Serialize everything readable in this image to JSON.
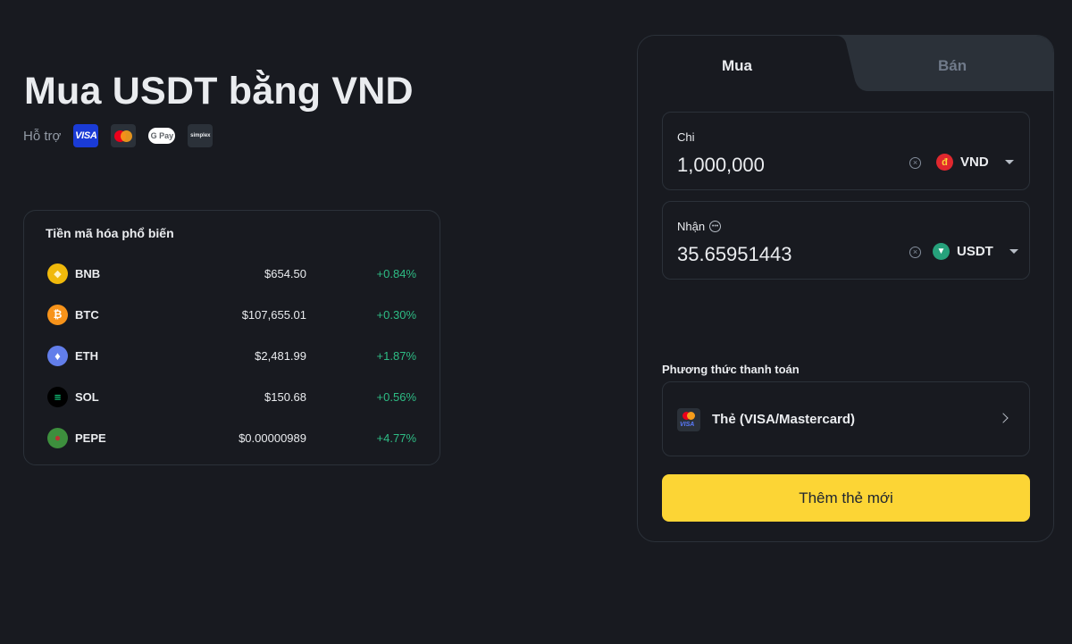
{
  "hero": {
    "title": "Mua USDT bằng VND",
    "support_label": "Hỗ trợ",
    "payment_logos": [
      {
        "icon": "visa-icon",
        "text": "VISA"
      },
      {
        "icon": "mastercard-icon"
      },
      {
        "icon": "google-pay-icon",
        "text": "G Pay"
      },
      {
        "icon": "simplex-icon",
        "text": "simplex"
      }
    ]
  },
  "popular": {
    "title": "Tiền mã hóa phổ biến",
    "coins": [
      {
        "symbol": "BNB",
        "price": "$654.50",
        "change": "+0.84%",
        "icon": "bnb-icon",
        "color": "#f0b90b"
      },
      {
        "symbol": "BTC",
        "price": "$107,655.01",
        "change": "+0.30%",
        "icon": "btc-icon",
        "color": "#f7931a"
      },
      {
        "symbol": "ETH",
        "price": "$2,481.99",
        "change": "+1.87%",
        "icon": "eth-icon",
        "color": "#627eea"
      },
      {
        "symbol": "SOL",
        "price": "$150.68",
        "change": "+0.56%",
        "icon": "sol-icon",
        "color": "#000000"
      },
      {
        "symbol": "PEPE",
        "price": "$0.00000989",
        "change": "+4.77%",
        "icon": "pepe-icon",
        "color": "#3d8f3d"
      }
    ]
  },
  "trade": {
    "tabs": {
      "buy": "Mua",
      "sell": "Bán"
    },
    "spend": {
      "label": "Chi",
      "value": "1,000,000",
      "currency": "VND",
      "currency_symbol": "đ"
    },
    "receive": {
      "label": "Nhận",
      "value": "35.65951443",
      "currency": "USDT"
    },
    "payment_method_label": "Phương thức thanh toán",
    "payment_method": "Thẻ (VISA/Mastercard)",
    "add_card_label": "Thêm thẻ mới",
    "card_icon_text": "VISA"
  },
  "colors": {
    "background": "#181a20",
    "accent": "#fcd535",
    "positive": "#2ebd85",
    "border": "#2b3139"
  }
}
